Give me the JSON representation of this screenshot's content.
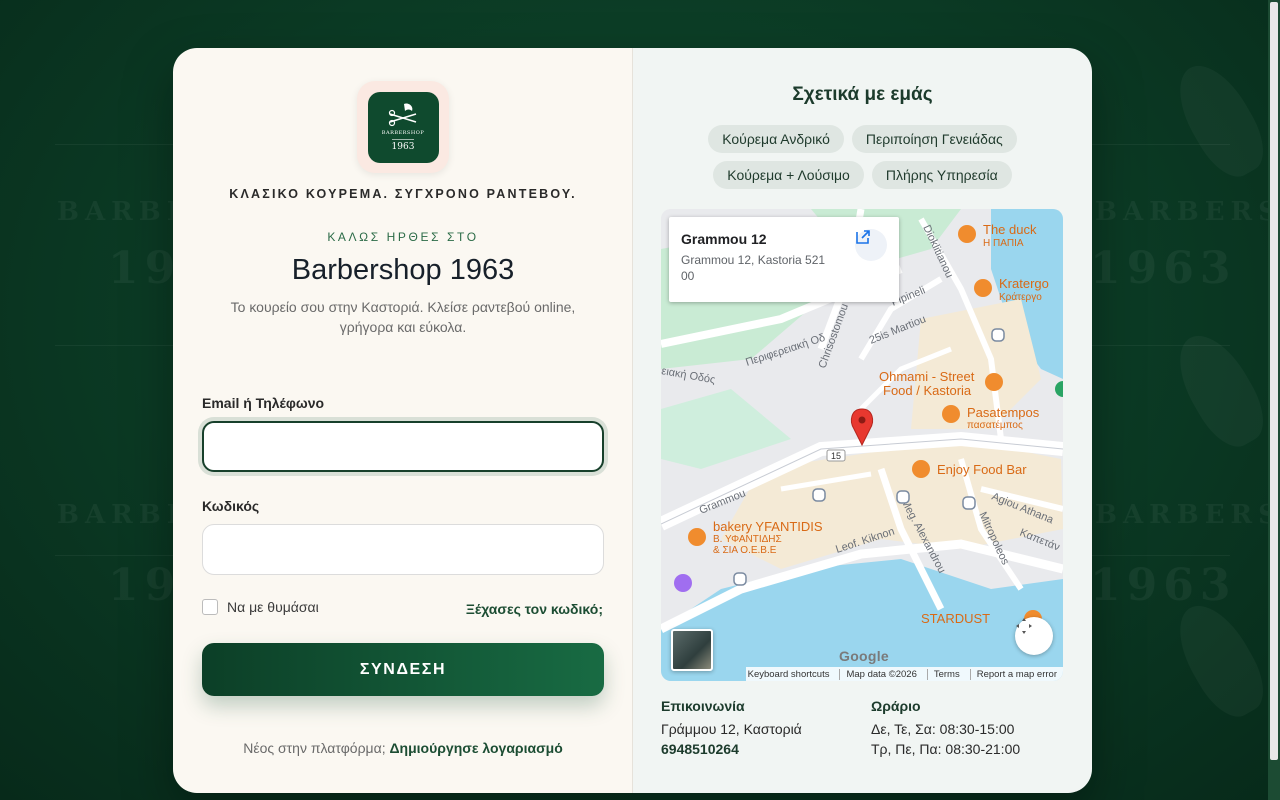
{
  "background": {
    "watermark_brand": "BARBERSHOP",
    "watermark_year": "1963"
  },
  "logo": {
    "name": "BARBERSHOP",
    "year": "1963"
  },
  "left": {
    "tagline": "ΚΛΑΣΙΚΟ ΚΟΥΡΕΜΑ. ΣΥΓΧΡΟΝΟ ΡΑΝΤΕΒΟΥ.",
    "welcome": "ΚΑΛΩΣ ΗΡΘΕΣ ΣΤΟ",
    "title": "Barbershop 1963",
    "description": "Το κουρείο σου στην Καστοριά. Κλείσε ραντεβού online, γρήγορα και εύκολα.",
    "email_label": "Email ή Τηλέφωνο",
    "email_value": "",
    "password_label": "Κωδικός",
    "password_value": "",
    "remember_label": "Να με θυμάσαι",
    "forgot_label": "Ξέχασες τον κωδικό;",
    "login_label": "ΣΥΝΔΕΣΗ",
    "signup_prompt": "Νέος στην πλατφόρμα;",
    "signup_link": "Δημιούργησε λογαριασμό"
  },
  "right": {
    "about_title": "Σχετικά με εμάς",
    "services": [
      "Κούρεμα Ανδρικό",
      "Περιποίηση Γενειάδας",
      "Κούρεμα + Λούσιμο",
      "Πλήρης Υπηρεσία"
    ],
    "map": {
      "place_title": "Grammou 12",
      "place_address": "Grammou 12, Kastoria 521 00",
      "google": "Google",
      "footer": [
        "Keyboard shortcuts",
        "Map data ©2026",
        "Terms",
        "Report a map error"
      ],
      "labels": {
        "the_duck": "The duck",
        "the_duck_gr": "Η ΠΑΠΙΑ",
        "kratergo": "Kratergo",
        "kratergo_gr": "Κράτεργο",
        "ohmami_1": "Ohmami - Street",
        "ohmami_2": "Food / Kastoria",
        "pasatempos": "Pasatempos",
        "pasatempos_gr": "πασατέμπος",
        "enjoy": "Enjoy Food Bar",
        "bakery": "bakery YFANTIDIS",
        "bakery_gr1": "Β. ΥΦΑΝΤΙΔΗΣ",
        "bakery_gr2": "& ΣΙΑ Ο.Ε.Β.Ε",
        "stardust": "STARDUST",
        "grammou": "Grammou",
        "leof": "Leof. Kiknon",
        "meg": "Meg. Alexandrou",
        "mitropoleos": "Mitropoleos",
        "agiou": "Agiou Athana",
        "kapetan": "Καπετάν",
        "pipineli": "Pipineli",
        "martiou": "25is Martiou",
        "chrisostomou": "Chrisostomou",
        "dioklitianou": "Dioklitianou",
        "perifereiaki": "Περιφερειακή Οδ",
        "periakh": "ειακή Οδός",
        "route": "15"
      }
    },
    "contact_title": "Επικοινωνία",
    "contact_address": "Γράμμου 12, Καστοριά",
    "contact_phone": "6948510264",
    "hours_title": "Ωράριο",
    "hours_line1": "Δε, Τε, Σα: 08:30-15:00",
    "hours_line2": "Τρ, Πε, Πα: 08:30-21:00"
  }
}
